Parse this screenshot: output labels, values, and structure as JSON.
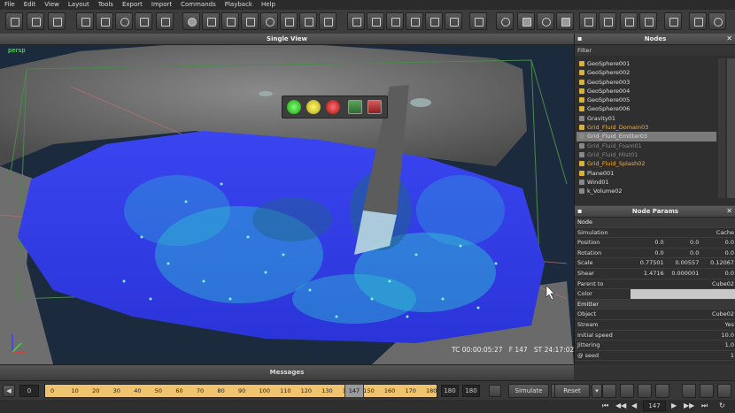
{
  "menu": [
    "File",
    "Edit",
    "View",
    "Layout",
    "Tools",
    "Export",
    "Import",
    "Commands",
    "Playback",
    "Help"
  ],
  "viewport": {
    "title": "Single View",
    "camera_label": "persp",
    "hud": [
      "TC 00:00:05:27",
      "F 147",
      "ST 24:17:02"
    ]
  },
  "nodes": {
    "title": "Nodes",
    "filter_label": "Filter",
    "items": [
      {
        "label": "GeoSphere001",
        "style": "yellow"
      },
      {
        "label": "GeoSphere002",
        "style": "yellow"
      },
      {
        "label": "GeoSphere003",
        "style": "yellow"
      },
      {
        "label": "GeoSphere004",
        "style": "yellow"
      },
      {
        "label": "GeoSphere005",
        "style": "yellow"
      },
      {
        "label": "GeoSphere006",
        "style": "yellow"
      },
      {
        "label": "Gravity01",
        "style": "gray"
      },
      {
        "label": "Grid_Fluid_Domain03",
        "style": "orange"
      },
      {
        "label": "Grid_Fluid_Emitter03",
        "style": "selected"
      },
      {
        "label": "Grid_Fluid_Foam01",
        "style": "dim"
      },
      {
        "label": "Grid_Fluid_Mist01",
        "style": "dim"
      },
      {
        "label": "Grid_Fluid_Splash02",
        "style": "orange"
      },
      {
        "label": "Plane001",
        "style": "yellow"
      },
      {
        "label": "Wind01",
        "style": "gray"
      },
      {
        "label": "k_Volume02",
        "style": "gray"
      }
    ]
  },
  "params": {
    "title": "Node Params",
    "node_section": "Node",
    "rows": [
      {
        "label": "Simulation",
        "values": [
          "Cache"
        ]
      },
      {
        "label": "Position",
        "values": [
          "0.0",
          "0.0",
          "0.0"
        ]
      },
      {
        "label": "Rotation",
        "values": [
          "0.0",
          "0.0",
          "0.0"
        ]
      },
      {
        "label": "Scale",
        "values": [
          "0.77501",
          "0.00557",
          "0.12067"
        ]
      },
      {
        "label": "Shear",
        "values": [
          "1.4716",
          "0.000001",
          "0.0"
        ]
      },
      {
        "label": "Parent to",
        "values": [
          "Cube02"
        ]
      },
      {
        "label": "Color",
        "values": [
          ""
        ]
      }
    ],
    "emitter_section": "Emitter",
    "emitter_rows": [
      {
        "label": "Object",
        "value": "Cube02"
      },
      {
        "label": "Stream",
        "value": "Yes"
      },
      {
        "label": "Initial speed",
        "value": "10.0"
      },
      {
        "label": "Jittering",
        "value": "1.0"
      },
      {
        "label": "@ seed",
        "value": "1"
      }
    ]
  },
  "messages": {
    "title": "Messages"
  },
  "timeline": {
    "start": "0",
    "ticks": [
      "0",
      "10",
      "20",
      "30",
      "40",
      "50",
      "60",
      "70",
      "80",
      "90",
      "100",
      "110",
      "120",
      "130",
      "140",
      "150",
      "160",
      "170",
      "180"
    ],
    "current_frame": "147",
    "end_a": "180",
    "end_b": "180",
    "simulate_label": "Simulate",
    "reset_label": "Reset",
    "frame_field": "147"
  }
}
